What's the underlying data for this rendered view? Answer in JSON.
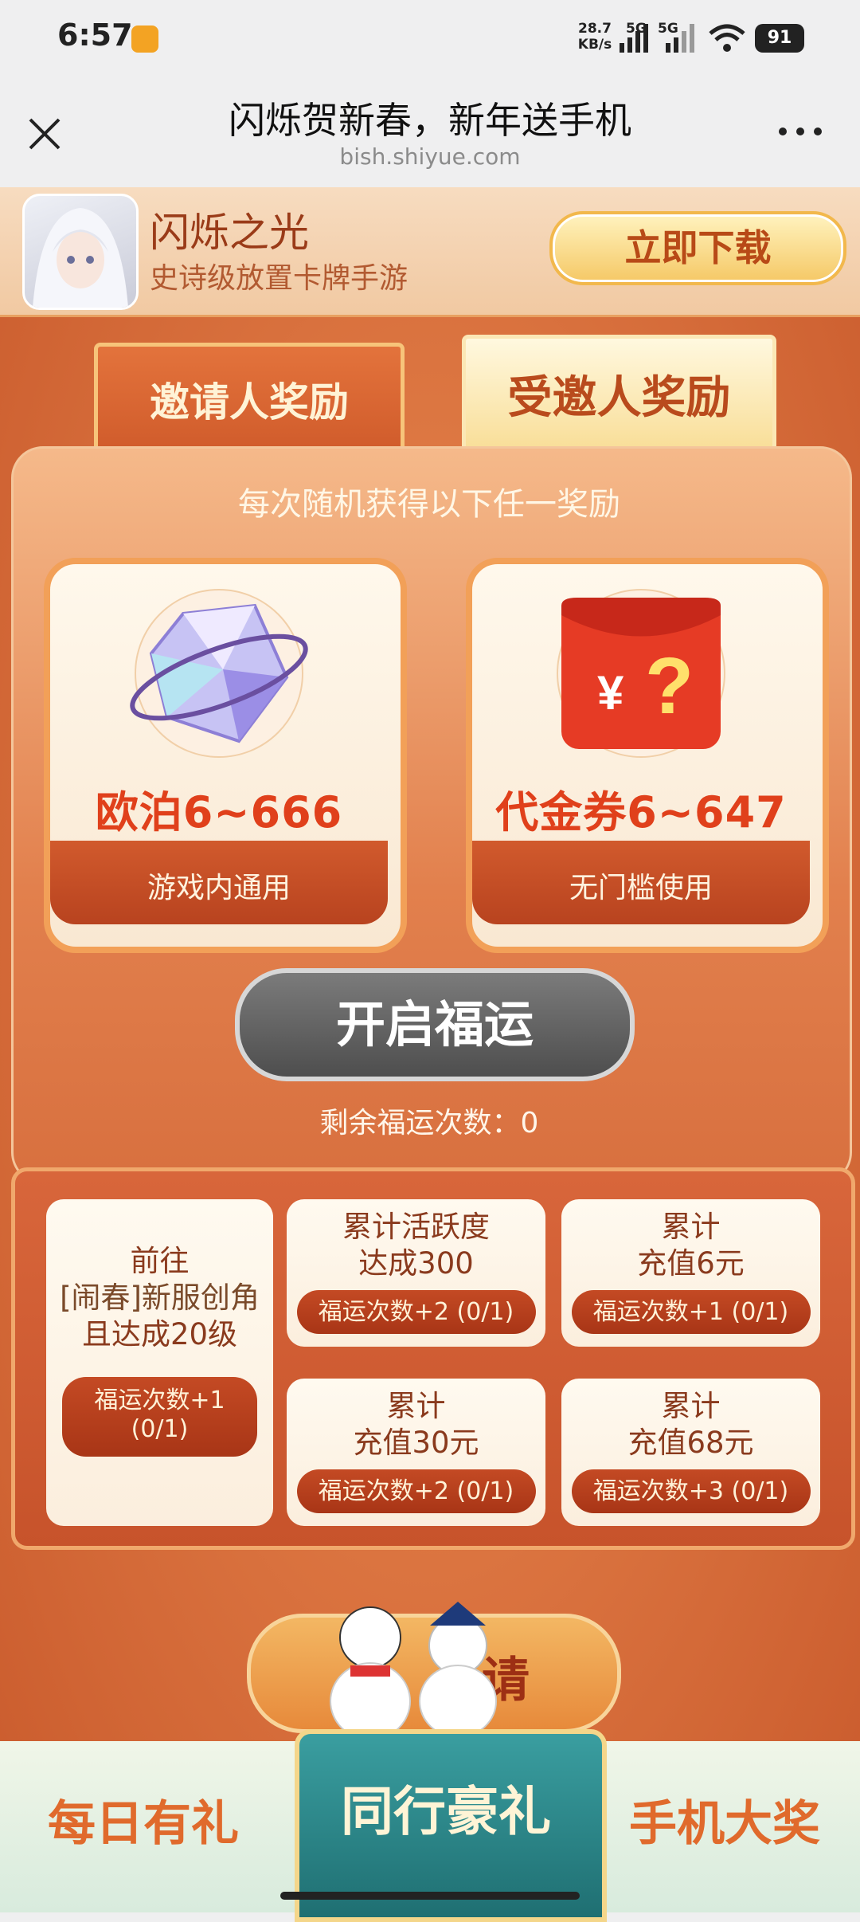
{
  "status_bar": {
    "time": "6:57",
    "net_speed": "28.7\nKB/s",
    "net_speed_line1": "28.7",
    "net_speed_line2": "KB/s",
    "sim1_label": "5G",
    "sim2_label": "5G",
    "battery": "91"
  },
  "title_bar": {
    "title": "闪烁贺新春，新年送手机",
    "url": "bish.shiyue.com"
  },
  "game": {
    "name": "闪烁之光",
    "description": "史诗级放置卡牌手游",
    "download_label": "立即下载"
  },
  "tabs": [
    {
      "label": "邀请人奖励",
      "active": false
    },
    {
      "label": "受邀人奖励",
      "active": true
    }
  ],
  "rewards": {
    "heading": "每次随机获得以下任一奖励",
    "items": [
      {
        "value": "欧泊6~666",
        "note": "游戏内通用",
        "icon": "crystal-icon"
      },
      {
        "value": "代金券6~647",
        "note": "无门槛使用",
        "icon": "red-envelope-icon"
      }
    ]
  },
  "fortune": {
    "button_label": "开启福运",
    "remaining_label": "剩余福运次数：0"
  },
  "tasks": [
    {
      "line1": "前往",
      "line2": "[闹春]新服创角",
      "line3": "且达成20级",
      "reward_line1": "福运次数+1",
      "reward_line2": "(0/1)"
    },
    {
      "line1": "累计活跃度",
      "line2": "达成300",
      "reward": "福运次数+2 (0/1)"
    },
    {
      "line1": "累计",
      "line2": "充值6元",
      "reward": "福运次数+1 (0/1)"
    },
    {
      "line1": "累计",
      "line2": "充值30元",
      "reward": "福运次数+2 (0/1)"
    },
    {
      "line1": "累计",
      "line2": "充值68元",
      "reward": "福运次数+3 (0/1)"
    }
  ],
  "invite_list": {
    "title_visible": "请"
  },
  "bottom_nav": {
    "daily": "每日有礼",
    "together": "同行豪礼",
    "phone": "手机大奖"
  },
  "colors": {
    "accent_orange": "#db7440",
    "reward_red": "#e0401b",
    "teal": "#1f6f72"
  }
}
